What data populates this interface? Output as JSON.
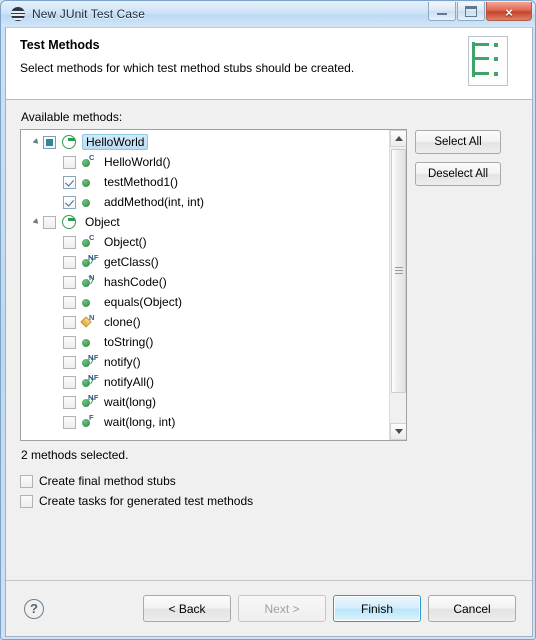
{
  "window": {
    "title": "New JUnit Test Case",
    "icon": "junit-icon",
    "controls": {
      "minimize": "minimize-icon",
      "maximize": "maximize-icon",
      "close": "×"
    }
  },
  "banner": {
    "heading": "Test Methods",
    "description": "Select methods for which test method stubs should be created.",
    "icon": "junit-wizard-icon"
  },
  "main": {
    "list_label": "Available methods:",
    "status": "2 methods selected.",
    "side_buttons": [
      {
        "label": "Select All",
        "name": "select-all-button"
      },
      {
        "label": "Deselect All",
        "name": "deselect-all-button"
      }
    ],
    "options": [
      {
        "label": "Create final method stubs",
        "checked": false,
        "name": "create-final-method-stubs-checkbox"
      },
      {
        "label": "Create tasks for generated test methods",
        "checked": false,
        "name": "create-tasks-checkbox"
      }
    ]
  },
  "tree": {
    "nodes": [
      {
        "label": "HelloWorld",
        "level": 0,
        "icon": "java-class-icon",
        "check": "grayed",
        "selected": true,
        "expanded": true,
        "modifiers": ""
      },
      {
        "label": "HelloWorld()",
        "level": 1,
        "icon": "public-method-icon",
        "check": "unchecked",
        "selected": false,
        "modifiers": "C"
      },
      {
        "label": "testMethod1()",
        "level": 1,
        "icon": "public-method-icon",
        "check": "checked",
        "selected": false,
        "modifiers": ""
      },
      {
        "label": "addMethod(int, int)",
        "level": 1,
        "icon": "public-method-icon",
        "check": "checked",
        "selected": false,
        "modifiers": ""
      },
      {
        "label": "Object",
        "level": 0,
        "icon": "java-class-icon",
        "check": "unchecked",
        "selected": false,
        "expanded": true,
        "modifiers": ""
      },
      {
        "label": "Object()",
        "level": 1,
        "icon": "public-method-icon",
        "check": "unchecked",
        "selected": false,
        "modifiers": "C"
      },
      {
        "label": "getClass()",
        "level": 1,
        "icon": "public-method-icon",
        "check": "unchecked",
        "selected": false,
        "modifiers": "NF"
      },
      {
        "label": "hashCode()",
        "level": 1,
        "icon": "public-method-icon",
        "check": "unchecked",
        "selected": false,
        "modifiers": "N"
      },
      {
        "label": "equals(Object)",
        "level": 1,
        "icon": "public-method-icon",
        "check": "unchecked",
        "selected": false,
        "modifiers": ""
      },
      {
        "label": "clone()",
        "level": 1,
        "icon": "protected-method-icon",
        "check": "unchecked",
        "selected": false,
        "modifiers": "N"
      },
      {
        "label": "toString()",
        "level": 1,
        "icon": "public-method-icon",
        "check": "unchecked",
        "selected": false,
        "modifiers": ""
      },
      {
        "label": "notify()",
        "level": 1,
        "icon": "public-method-icon",
        "check": "unchecked",
        "selected": false,
        "modifiers": "NF"
      },
      {
        "label": "notifyAll()",
        "level": 1,
        "icon": "public-method-icon",
        "check": "unchecked",
        "selected": false,
        "modifiers": "NF"
      },
      {
        "label": "wait(long)",
        "level": 1,
        "icon": "public-method-icon",
        "check": "unchecked",
        "selected": false,
        "modifiers": "NF"
      },
      {
        "label": "wait(long, int)",
        "level": 1,
        "icon": "public-method-icon",
        "check": "unchecked",
        "selected": false,
        "modifiers": "F"
      }
    ]
  },
  "footer": {
    "help": "?",
    "buttons": [
      {
        "label": "< Back",
        "name": "back-button",
        "state": "enabled"
      },
      {
        "label": "Next >",
        "name": "next-button",
        "state": "disabled"
      },
      {
        "label": "Finish",
        "name": "finish-button",
        "state": "default"
      },
      {
        "label": "Cancel",
        "name": "cancel-button",
        "state": "enabled"
      }
    ]
  },
  "colors": {
    "accent_green": "#3f9a57",
    "selection_blue": "#b9ddf2",
    "default_button_border": "#2e9ad0",
    "close_red": "#c6432c"
  }
}
